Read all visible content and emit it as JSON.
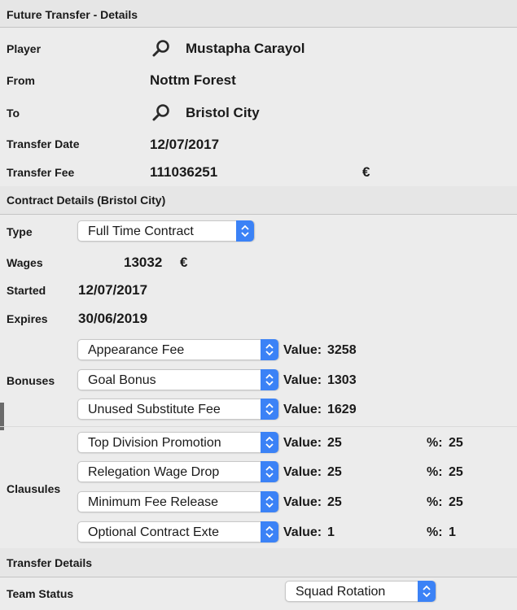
{
  "header": {
    "title": "Future Transfer - Details"
  },
  "player": {
    "label": "Player",
    "value": "Mustapha Carayol",
    "icon": "magnifier-icon"
  },
  "from": {
    "label": "From",
    "value": "Nottm Forest"
  },
  "to": {
    "label": "To",
    "value": "Bristol City",
    "icon": "magnifier-icon"
  },
  "transfer_date": {
    "label": "Transfer Date",
    "value": "12/07/2017"
  },
  "transfer_fee": {
    "label": "Transfer Fee",
    "value": "111036251",
    "currency": "€"
  },
  "contract_section": {
    "title": "Contract Details (Bristol City)"
  },
  "type": {
    "label": "Type",
    "selected": "Full Time Contract"
  },
  "wages": {
    "label": "Wages",
    "value": "13032",
    "currency": "€"
  },
  "started": {
    "label": "Started",
    "value": "12/07/2017"
  },
  "expires": {
    "label": "Expires",
    "value": "30/06/2019"
  },
  "bonuses": {
    "label": "Bonuses",
    "items": [
      {
        "selected": "Appearance Fee",
        "value_label": "Value:",
        "value": "3258"
      },
      {
        "selected": "Goal Bonus",
        "value_label": "Value:",
        "value": "1303"
      },
      {
        "selected": "Unused Substitute Fee",
        "value_label": "Value:",
        "value": "1629"
      }
    ]
  },
  "clausules": {
    "label": "Clausules",
    "items": [
      {
        "selected": "Top Division Promotion",
        "value_label": "Value:",
        "value": "25",
        "pct_label": "%:",
        "pct": "25"
      },
      {
        "selected": "Relegation Wage Drop",
        "value_label": "Value:",
        "value": "25",
        "pct_label": "%:",
        "pct": "25"
      },
      {
        "selected": "Minimum Fee Release",
        "value_label": "Value:",
        "value": "25",
        "pct_label": "%:",
        "pct": "25"
      },
      {
        "selected": "Optional Contract Exte",
        "value_label": "Value:",
        "value": "1",
        "pct_label": "%:",
        "pct": "1"
      }
    ]
  },
  "transfer_details_section": {
    "title": "Transfer Details"
  },
  "team_status": {
    "label": "Team Status",
    "selected": "Squad Rotation"
  },
  "colors": {
    "accent": "#3b82f6",
    "background": "#ececec",
    "divider": "#c4c4c4"
  }
}
